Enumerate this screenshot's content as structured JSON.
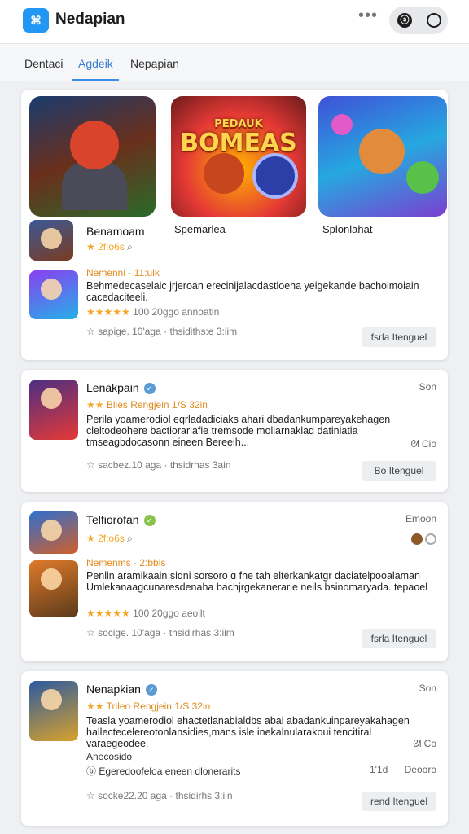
{
  "app": {
    "title": "Nedapian",
    "logo_glyph": "⌘",
    "more_glyph": "•••",
    "pill_icon_a": "ⓐ"
  },
  "tabs": [
    {
      "label": "Dentaci",
      "active": false
    },
    {
      "label": "Agdeik",
      "active": true
    },
    {
      "label": "Nepapian",
      "active": false
    }
  ],
  "colors": {
    "accent": "#3a8ee6",
    "star": "#f5a623",
    "highlight": "#e08a1e"
  },
  "featured": {
    "art2_title_top": "PEDAUK",
    "art2_title": "BOMEAS",
    "captions": [
      "Spemarlea",
      "Splonlahat"
    ],
    "item1": {
      "name": "Benamoam",
      "rating": "★ 2f:o6s",
      "search_icon": "search-icon",
      "headline": "Nemenni · 11:ulk",
      "desc": "Behmedecaselaic jrjeroan erecinijalacdastloeha yeigekande bacholmoiain cacedaciteeli.",
      "stars": "★★★★★",
      "stars_text": "100 20ggo annoatin",
      "meta": "sapige. 10'aga · thsidiths:e 3:iim",
      "action": "fsrla  Itenguel"
    }
  },
  "cards": [
    {
      "name": "Lenakpain",
      "tag": "Son",
      "stars": "★★",
      "subtitle": "Blies Rengjein 1/S 32in",
      "desc": "Perila yoamerodiol eqrladadiciaks ahari dbadankumpareyakehagen cleltodeohere bactiorariafie tremsode moliarnaklad datiniatia tmseagbdocasonn eineen Bereeih...",
      "side_tag": "ᘛ Cio",
      "meta": "sacbez.10 aga · thsidrhas 3ain",
      "action": "Bo  Itenguel"
    },
    {
      "name": "Telfiorofan",
      "tag": "Emoon",
      "rating": "★ 2f:o6s",
      "headline": "Nemenms · 2:bbls",
      "desc": "Penlin aramikaain sidni sorsoro ɑ fne tah elterkankatgr daciatelpooalaman Umlekanaagcunaresdenaha bachjrgekanerarie neils bsinomaryada. tepaoel",
      "stars": "★★★★★",
      "stars_text": "100 20ggo aeoilt",
      "meta": "socige. 10'aga · thsidirhas 3:iim",
      "action": "fsrla  Itenguel"
    },
    {
      "name": "Nenapkian",
      "tag": "Son",
      "stars": "★★",
      "subtitle": "Trileo Rengjein 1/S 32in",
      "desc": "Teasla yoamerodiol ehactetlanabialdbs abai abadankuinpareyakahagen hallectecelereotonlansidies,mans isle inekalnularakoui tencitiral varaegeodee.",
      "extra": "Anecosido",
      "extra2": "ⓑ Egeredoofeloa eneen dlonerarits",
      "side_tag": "ᘛ Co",
      "count": "1'1d",
      "count_label": "Deooro",
      "meta": "socke22.20 aga · thsidirhs 3:iin",
      "action": "rend  Itenguel"
    }
  ]
}
